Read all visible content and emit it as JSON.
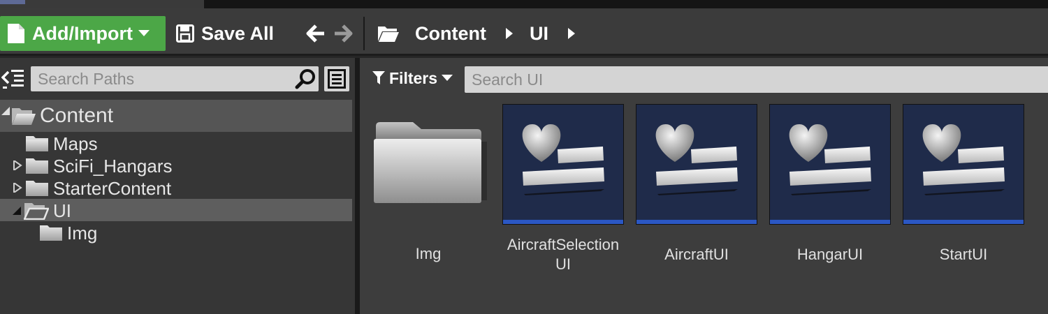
{
  "toolbar": {
    "add_import_label": "Add/Import",
    "save_all_label": "Save All",
    "breadcrumbs": [
      "Content",
      "UI"
    ]
  },
  "left_panel": {
    "search_placeholder": "Search Paths",
    "tree": [
      {
        "label": "Content",
        "level": 0,
        "expanded": true
      },
      {
        "label": "Maps",
        "level": 1,
        "expanded": false
      },
      {
        "label": "SciFi_Hangars",
        "level": 1,
        "expanded": false
      },
      {
        "label": "StarterContent",
        "level": 1,
        "expanded": false
      },
      {
        "label": "UI",
        "level": 1,
        "expanded": true,
        "selected": true
      },
      {
        "label": "Img",
        "level": 2,
        "expanded": false
      }
    ]
  },
  "right_panel": {
    "filters_label": "Filters",
    "search_placeholder": "Search UI",
    "assets": [
      {
        "name": "Img",
        "type": "folder"
      },
      {
        "name": "AircraftSelection\nUI",
        "name_line1": "AircraftSelection",
        "name_line2": "UI",
        "type": "widget-blueprint"
      },
      {
        "name": "AircraftUI",
        "type": "widget-blueprint"
      },
      {
        "name": "HangarUI",
        "type": "widget-blueprint"
      },
      {
        "name": "StartUI",
        "type": "widget-blueprint"
      }
    ]
  },
  "colors": {
    "add_button": "#4ca747",
    "selection": "#5e5e5e",
    "widget_thumb": "#1f2b4a",
    "widget_bar": "#2b57c4"
  },
  "icons": [
    "new-document-icon",
    "save-icon",
    "back-arrow-icon",
    "forward-arrow-icon",
    "folder-open-icon",
    "chevron-right-icon",
    "tree-toggle-icon",
    "search-icon",
    "view-options-icon",
    "filter-icon",
    "folder-icon",
    "heart-icon"
  ]
}
